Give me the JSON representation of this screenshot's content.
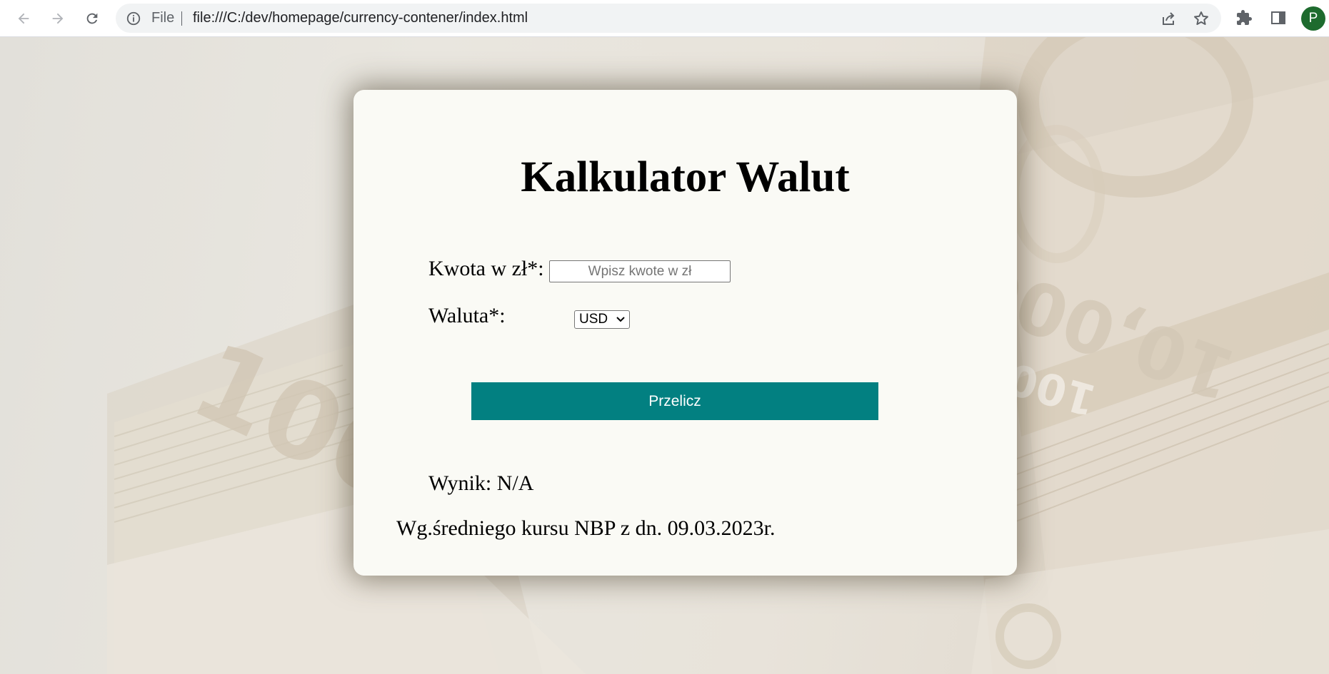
{
  "browser": {
    "scheme_label": "File",
    "url": "file:///C:/dev/homepage/currency-contener/index.html",
    "profile_initial": "P",
    "profile_color": "#1e6b2e"
  },
  "calculator": {
    "title": "Kalkulator Walut",
    "amount_label": "Kwota w zł*:",
    "amount_placeholder": "Wpisz kwote w zł",
    "amount_value": "",
    "currency_label": "Waluta*:",
    "currency_selected": "USD",
    "convert_button": "Przelicz",
    "result_label": "Wynik:",
    "result_value": "N/A",
    "rate_note": "Wg.średniego kursu NBP z dn. 09.03.2023r."
  },
  "colors": {
    "accent": "#028081",
    "card_background": "#fafaf5"
  }
}
